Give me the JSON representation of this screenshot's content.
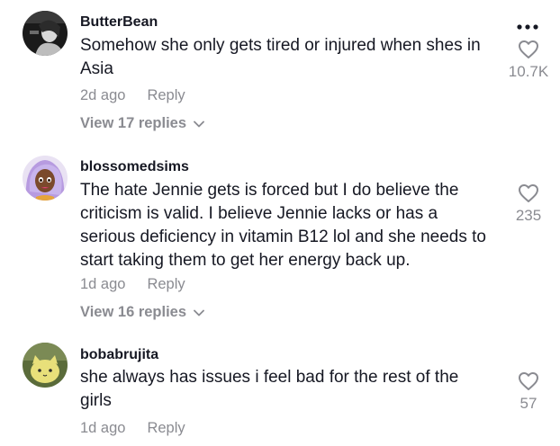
{
  "comments": [
    {
      "username": "ButterBean",
      "text": "Somehow she only gets tired or injured when shes in Asia",
      "time": "2d ago",
      "reply_label": "Reply",
      "view_replies": "View 17 replies",
      "likes": "10.7K",
      "avatar_icon": "avatar-photo-icon"
    },
    {
      "username": "blossomedsims",
      "text": "The hate Jennie gets is forced but I do believe the criticism is valid. I believe Jennie lacks or has a serious deficiency in vitamin B12 lol and she needs to start taking them to get her energy back up.",
      "time": "1d ago",
      "reply_label": "Reply",
      "view_replies": "View 16 replies",
      "likes": "235",
      "avatar_icon": "avatar-cartoon-icon"
    },
    {
      "username": "bobabrujita",
      "text": "she always has issues i feel bad for the rest of the girls",
      "time": "1d ago",
      "reply_label": "Reply",
      "likes": "57",
      "avatar_icon": "avatar-cat-icon"
    }
  ],
  "icons": {
    "more": "more-options-icon",
    "like": "heart-outline-icon",
    "chevron": "chevron-down-icon"
  },
  "colors": {
    "text": "#161823",
    "secondary": "#8a8b91"
  }
}
